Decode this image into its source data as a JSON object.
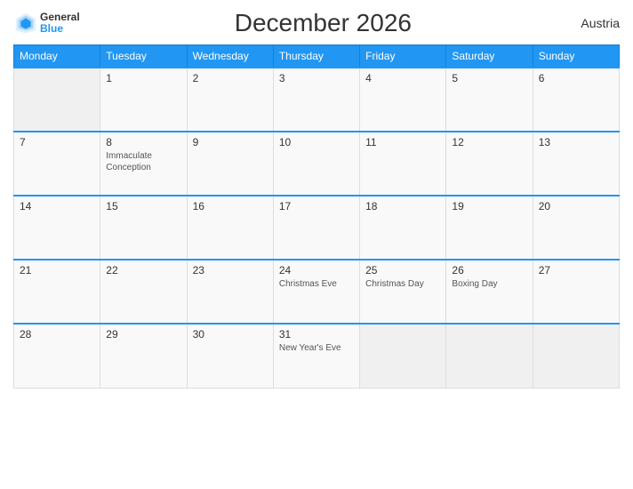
{
  "header": {
    "logo_general": "General",
    "logo_blue": "Blue",
    "title": "December 2026",
    "country": "Austria"
  },
  "weekdays": [
    "Monday",
    "Tuesday",
    "Wednesday",
    "Thursday",
    "Friday",
    "Saturday",
    "Sunday"
  ],
  "weeks": [
    [
      {
        "day": "",
        "holiday": ""
      },
      {
        "day": "1",
        "holiday": ""
      },
      {
        "day": "2",
        "holiday": ""
      },
      {
        "day": "3",
        "holiday": ""
      },
      {
        "day": "4",
        "holiday": ""
      },
      {
        "day": "5",
        "holiday": ""
      },
      {
        "day": "6",
        "holiday": ""
      }
    ],
    [
      {
        "day": "7",
        "holiday": ""
      },
      {
        "day": "8",
        "holiday": "Immaculate\nConception"
      },
      {
        "day": "9",
        "holiday": ""
      },
      {
        "day": "10",
        "holiday": ""
      },
      {
        "day": "11",
        "holiday": ""
      },
      {
        "day": "12",
        "holiday": ""
      },
      {
        "day": "13",
        "holiday": ""
      }
    ],
    [
      {
        "day": "14",
        "holiday": ""
      },
      {
        "day": "15",
        "holiday": ""
      },
      {
        "day": "16",
        "holiday": ""
      },
      {
        "day": "17",
        "holiday": ""
      },
      {
        "day": "18",
        "holiday": ""
      },
      {
        "day": "19",
        "holiday": ""
      },
      {
        "day": "20",
        "holiday": ""
      }
    ],
    [
      {
        "day": "21",
        "holiday": ""
      },
      {
        "day": "22",
        "holiday": ""
      },
      {
        "day": "23",
        "holiday": ""
      },
      {
        "day": "24",
        "holiday": "Christmas Eve"
      },
      {
        "day": "25",
        "holiday": "Christmas Day"
      },
      {
        "day": "26",
        "holiday": "Boxing Day"
      },
      {
        "day": "27",
        "holiday": ""
      }
    ],
    [
      {
        "day": "28",
        "holiday": ""
      },
      {
        "day": "29",
        "holiday": ""
      },
      {
        "day": "30",
        "holiday": ""
      },
      {
        "day": "31",
        "holiday": "New Year's Eve"
      },
      {
        "day": "",
        "holiday": ""
      },
      {
        "day": "",
        "holiday": ""
      },
      {
        "day": "",
        "holiday": ""
      }
    ]
  ]
}
